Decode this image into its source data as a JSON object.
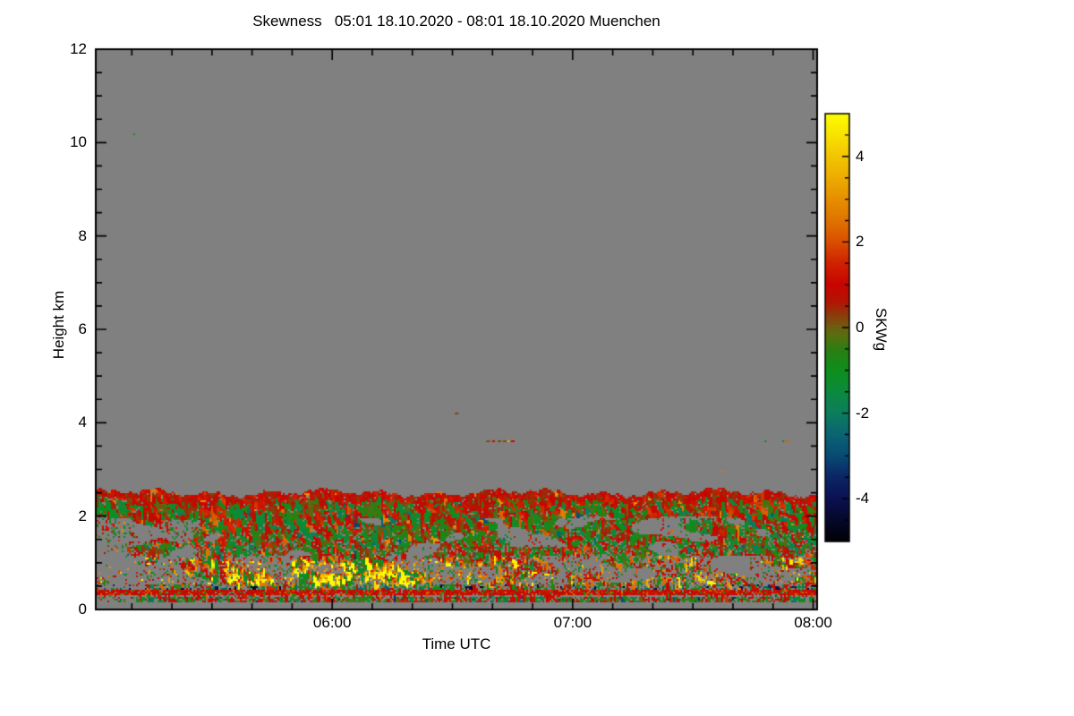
{
  "title": "Skewness   05:01 18.10.2020 - 08:01 18.10.2020 Muenchen",
  "axes": {
    "x": {
      "label": "Time UTC",
      "start": "05:01",
      "end": "08:01",
      "major_ticks": [
        {
          "minutes": 59,
          "label": "06:00"
        },
        {
          "minutes": 119,
          "label": "07:00"
        },
        {
          "minutes": 179,
          "label": "08:00"
        }
      ],
      "minor_tick_every_minutes": 10
    },
    "y": {
      "label": "Height km",
      "min": 0,
      "max": 12,
      "major_ticks": [
        {
          "km": 0,
          "label": "0"
        },
        {
          "km": 2,
          "label": "2"
        },
        {
          "km": 4,
          "label": "4"
        },
        {
          "km": 6,
          "label": "6"
        },
        {
          "km": 8,
          "label": "8"
        },
        {
          "km": 10,
          "label": "10"
        },
        {
          "km": 12,
          "label": "12"
        }
      ],
      "minor_tick_every_km": 0.5
    }
  },
  "colorbar": {
    "label": "SKWg",
    "min": -5,
    "max": 5,
    "major_ticks": [
      {
        "v": 4,
        "label": "4"
      },
      {
        "v": 2,
        "label": "2"
      },
      {
        "v": 0,
        "label": "0"
      },
      {
        "v": -2,
        "label": "-2"
      },
      {
        "v": -4,
        "label": "-4"
      }
    ],
    "minor_tick_every": 0.5,
    "stops": [
      [
        -5.0,
        "#000006"
      ],
      [
        -4.5,
        "#05082B"
      ],
      [
        -4.0,
        "#0B1152"
      ],
      [
        -3.5,
        "#0B2566"
      ],
      [
        -3.0,
        "#084B74"
      ],
      [
        -2.5,
        "#0A6472"
      ],
      [
        -2.0,
        "#0C7D5C"
      ],
      [
        -1.5,
        "#0B8A3E"
      ],
      [
        -1.0,
        "#0D8F1B"
      ],
      [
        -0.5,
        "#2D7D12"
      ],
      [
        -0.2,
        "#56700F"
      ],
      [
        0.0,
        "#6E5E12"
      ],
      [
        0.3,
        "#8C3A0A"
      ],
      [
        0.6,
        "#B31505"
      ],
      [
        1.0,
        "#C80400"
      ],
      [
        1.5,
        "#D02102"
      ],
      [
        2.0,
        "#D94E00"
      ],
      [
        2.5,
        "#DF7300"
      ],
      [
        3.0,
        "#E68F00"
      ],
      [
        3.5,
        "#ECAC00"
      ],
      [
        4.0,
        "#F2C400"
      ],
      [
        4.5,
        "#F9E200"
      ],
      [
        5.0,
        "#FDFD00"
      ]
    ]
  },
  "colors": {
    "no_data_gray": "#808080",
    "frame": "#000000",
    "page_background": "#ffffff"
  },
  "chart_data": {
    "type": "heatmap",
    "quantity": "Doppler spectrum skewness (SKWg)",
    "site": "Muenchen",
    "time_range_utc": [
      "05:01 18.10.2020",
      "08:01 18.10.2020"
    ],
    "height_range_km": [
      0,
      12
    ],
    "value_range": [
      -5,
      5
    ],
    "no_data_note": "uniform gray (no signal) everywhere above ~2.5 km except isolated specks",
    "seed": 42,
    "bands": [
      {
        "name": "cloud-canopy",
        "desc": "dense mottled green/red skewness streaks, top edge wavy at ~2.5 km, gray holes opening below 1.9 km",
        "h": [
          1.15,
          2.72
        ],
        "t": [
          0,
          180
        ],
        "coverage": 0.95,
        "dist": [
          [
            0.45,
            -1.7,
            -0.25
          ],
          [
            0.4,
            0.25,
            1.7
          ],
          [
            0.07,
            -0.25,
            0.25
          ],
          [
            0.05,
            1.7,
            3.2
          ],
          [
            0.03,
            -3.0,
            -1.7
          ]
        ]
      },
      {
        "name": "plume",
        "desc": "patchy band with strong positive skewness: orange/yellow streaks amid red/green, strongest 05:30-06:35",
        "h": [
          0.55,
          1.15
        ],
        "t": [
          0,
          180
        ],
        "coverage": 0.58,
        "dist": [
          [
            0.28,
            -1.5,
            -0.3
          ],
          [
            0.33,
            0.4,
            1.5
          ],
          [
            0.25,
            1.5,
            3.3
          ],
          [
            0.09,
            3.3,
            5.0
          ],
          [
            0.05,
            -0.2,
            0.2
          ]
        ]
      },
      {
        "name": "dark-spots",
        "desc": "thin layer with scattered strongly negative (teal/navy/black) cells, most around 06:00-06:40",
        "h": [
          0.42,
          0.55
        ],
        "t": [
          0,
          180
        ],
        "coverage": 0.62,
        "dist": [
          [
            0.3,
            -1.5,
            -0.3
          ],
          [
            0.25,
            0.3,
            1.3
          ],
          [
            0.2,
            -2.8,
            -1.2
          ],
          [
            0.15,
            -5.0,
            -2.8
          ],
          [
            0.1,
            1.5,
            3.0
          ]
        ]
      },
      {
        "name": "red-line",
        "desc": "nearly continuous bright red line at ~0.35 km across the whole record",
        "h": [
          0.32,
          0.42
        ],
        "t": [
          0,
          180
        ],
        "coverage": 0.95,
        "solid": true,
        "dist": [
          [
            0.8,
            0.7,
            1.4
          ],
          [
            0.12,
            1.5,
            2.5
          ],
          [
            0.08,
            -1.0,
            -0.2
          ]
        ]
      },
      {
        "name": "surface-speckle",
        "desc": "sparse mixed speckle below the red line, thin greenish line near 0.2 km, gray below ~0.15 km",
        "h": [
          0.14,
          0.3
        ],
        "t": [
          0,
          180
        ],
        "coverage": 0.4,
        "dist": [
          [
            0.4,
            -1.4,
            -0.3
          ],
          [
            0.3,
            0.4,
            1.4
          ],
          [
            0.15,
            -3.5,
            -1.5
          ],
          [
            0.15,
            -0.2,
            0.2
          ]
        ]
      }
    ],
    "specks": [
      {
        "t": 97.4,
        "h": 3.62,
        "len": 1.0,
        "v": 0.1
      },
      {
        "t": 98.9,
        "h": 3.62,
        "len": 0.7,
        "v": 0.8
      },
      {
        "t": 100.3,
        "h": 3.62,
        "len": 0.9,
        "v": 0.2
      },
      {
        "t": 101.6,
        "h": 3.62,
        "len": 1.5,
        "v": 0.15
      },
      {
        "t": 102.6,
        "h": 3.62,
        "len": 0.6,
        "v": 3.6
      },
      {
        "t": 103.6,
        "h": 3.62,
        "len": 0.9,
        "v": 1.1
      },
      {
        "t": 166.9,
        "h": 3.62,
        "len": 0.45,
        "v": -0.9
      },
      {
        "t": 171.3,
        "h": 3.62,
        "len": 0.5,
        "v": -0.9
      },
      {
        "t": 172.1,
        "h": 3.62,
        "len": 1.0,
        "v": 2.3
      },
      {
        "t": 156.1,
        "h": 2.97,
        "len": 0.5,
        "v": 2.6
      },
      {
        "t": 89.6,
        "h": 4.22,
        "len": 0.9,
        "v": 0.15
      },
      {
        "t": 9.3,
        "h": 10.2,
        "len": 0.4,
        "v": -0.9
      }
    ]
  }
}
